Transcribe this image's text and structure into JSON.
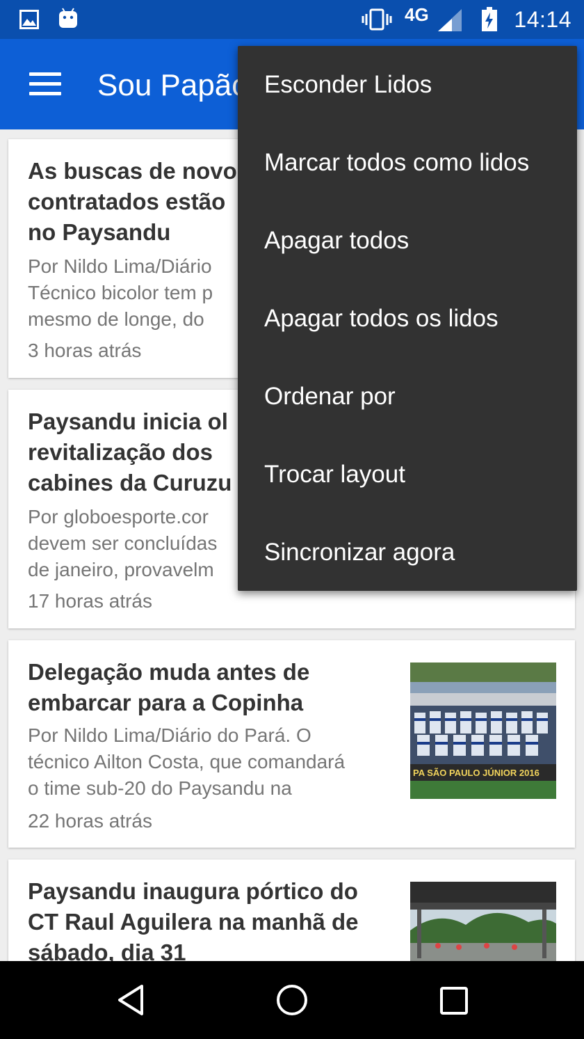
{
  "status_bar": {
    "network": "4G",
    "time": "14:14",
    "icons": [
      "image-icon",
      "android-icon",
      "vibrate-icon",
      "signal-icon",
      "battery-charging-icon"
    ]
  },
  "app_bar": {
    "title": "Sou Papão",
    "menu_icon": "hamburger-icon",
    "color": "#0d5fd6"
  },
  "articles": [
    {
      "title": "As buscas de novos\ncontratados estão\nno Paysandu",
      "snippet": "Por Nildo Lima/Diário\nTécnico bicolor tem p\nmesmo de longe, do",
      "time": "3 horas atrás"
    },
    {
      "title": "Paysandu inicia ol\nrevitalização  dos\ncabines da Curuzu",
      "snippet": "Por globoesporte.cor\ndevem ser concluídas\nde janeiro, provavelm",
      "time": "17 horas atrás"
    },
    {
      "title": "Delegação muda antes de\nembarcar para a Copinha",
      "snippet": "Por Nildo Lima/Diário do Pará. O\ntécnico Ailton Costa, que comandará\no time sub-20 do Paysandu na",
      "time": "22 horas atrás",
      "thumb_caption": "PA SÃO PAULO JÚNIOR 2016"
    },
    {
      "title": "Paysandu inaugura pórtico do\nCT Raul Aguilera na manhã de\nsábado, dia 31"
    }
  ],
  "overflow_menu": {
    "items": [
      "Esconder Lidos",
      "Marcar todos como lidos",
      "Apagar todos",
      "Apagar todos os lidos",
      "Ordenar por",
      "Trocar layout",
      "Sincronizar agora"
    ],
    "background": "#323232"
  },
  "nav_bar": {
    "buttons": [
      "back-icon",
      "home-icon",
      "recents-icon"
    ]
  }
}
